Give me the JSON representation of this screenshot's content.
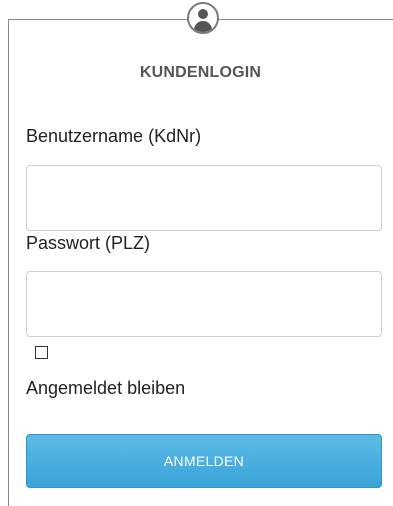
{
  "login": {
    "title": "KUNDENLOGIN",
    "username_label": "Benutzername (KdNr)",
    "username_value": "",
    "password_label": "Passwort (PLZ)",
    "password_value": "",
    "remember_label": "Angemeldet bleiben",
    "remember_checked": false,
    "submit_label": "ANMELDEN"
  },
  "icons": {
    "header": "user-icon"
  },
  "colors": {
    "button": "#3aa3d8",
    "button_text": "#ffffff",
    "title": "#555555",
    "border": "#888888"
  }
}
